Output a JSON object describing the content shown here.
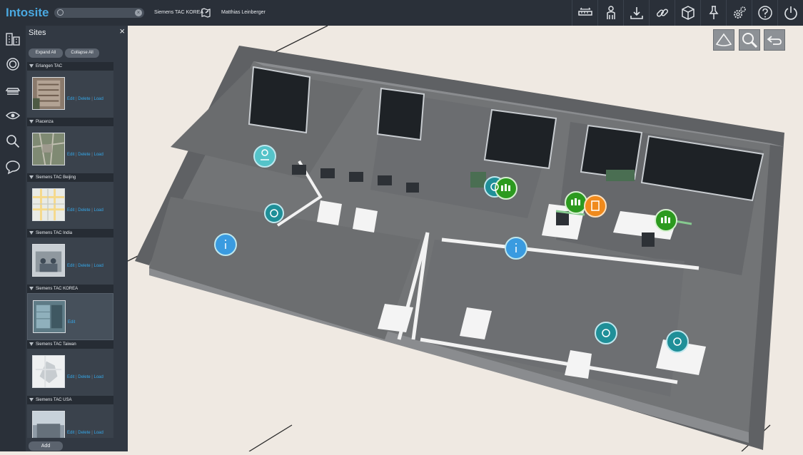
{
  "app": {
    "logo": "Intosite"
  },
  "topbar": {
    "search": {
      "placeholder": "",
      "value": ""
    },
    "current_site": "Siemens TAC KOREA",
    "user": "Matthias Leinberger",
    "tools": [
      {
        "icon": "measure-icon"
      },
      {
        "icon": "person-icon"
      },
      {
        "icon": "download-icon"
      },
      {
        "icon": "link-icon"
      },
      {
        "icon": "cube-icon"
      },
      {
        "icon": "pin-icon"
      },
      {
        "icon": "settings-icon"
      },
      {
        "icon": "help-icon"
      },
      {
        "icon": "power-icon"
      }
    ]
  },
  "sidebar_icons": [
    "buildings-icon",
    "target-icon",
    "layers-icon",
    "eye-icon",
    "search-icon",
    "comment-icon"
  ],
  "panel": {
    "title": "Sites",
    "close": "×",
    "expand_all": "Expand All",
    "collapse_all": "Collapse All",
    "add": "Add",
    "sites": [
      {
        "name": "Erlangen TAC",
        "edit": "Edit",
        "delete": "Delete",
        "load": "Load"
      },
      {
        "name": "Piacenza",
        "edit": "Edit",
        "delete": "Delete",
        "load": "Load"
      },
      {
        "name": "Siemens TAC Beijing",
        "edit": "Edit",
        "delete": "Delete",
        "load": "Load"
      },
      {
        "name": "Siemens TAC India",
        "edit": "Edit",
        "delete": "Delete",
        "load": "Load"
      },
      {
        "name": "Siemens TAC KOREA",
        "edit": "Edit",
        "selected": true
      },
      {
        "name": "Siemens TAC Taiwan",
        "edit": "Edit",
        "delete": "Delete",
        "load": "Load"
      },
      {
        "name": "Siemens TAC USA",
        "edit": "Edit",
        "delete": "Delete",
        "load": "Load"
      }
    ]
  },
  "viewport_tools": [
    {
      "icon": "view-cone-icon"
    },
    {
      "icon": "zoom-icon"
    },
    {
      "icon": "back-icon"
    }
  ],
  "colors": {
    "accent": "#35a7e8",
    "topbar": "#2a3039",
    "panel": "#323943",
    "marker_teal": "#1f8f98",
    "marker_green": "#2c9a1f",
    "marker_orange": "#f08a1c"
  }
}
